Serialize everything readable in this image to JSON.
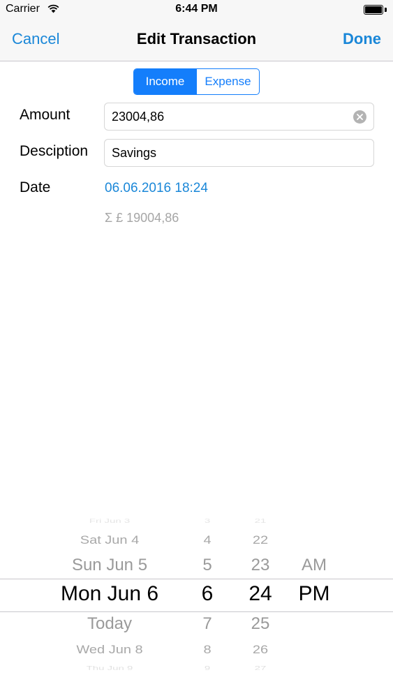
{
  "status_bar": {
    "carrier": "Carrier",
    "time": "6:44 PM"
  },
  "nav": {
    "cancel_label": "Cancel",
    "title": "Edit Transaction",
    "done_label": "Done"
  },
  "type_control": {
    "options": [
      "Income",
      "Expense"
    ],
    "selected": "Income"
  },
  "form": {
    "amount_label": "Amount",
    "amount_value": "23004,86",
    "description_label": "Desciption",
    "description_value": "Savings",
    "date_label": "Date",
    "date_value": "06.06.2016 18:24",
    "sum_text": "Σ £ 19004,86"
  },
  "picker": {
    "days": [
      "Fri Jun 3",
      "Sat Jun 4",
      "Sun Jun 5",
      "Mon Jun 6",
      "Today",
      "Wed Jun 8",
      "Thu Jun 9"
    ],
    "hours": [
      "3",
      "4",
      "5",
      "6",
      "7",
      "8",
      "9"
    ],
    "minutes": [
      "21",
      "22",
      "23",
      "24",
      "25",
      "26",
      "27"
    ],
    "ampm": [
      "AM",
      "PM"
    ],
    "selected": {
      "day": "Mon Jun 6",
      "hour": "6",
      "minute": "24",
      "ampm": "PM"
    }
  },
  "colors": {
    "tint": "#1a87d8",
    "segment": "#147efb",
    "muted": "#a6a6a6"
  },
  "icons": {
    "wifi": "wifi-icon",
    "battery": "battery-icon",
    "clear": "clear-circle-icon"
  }
}
